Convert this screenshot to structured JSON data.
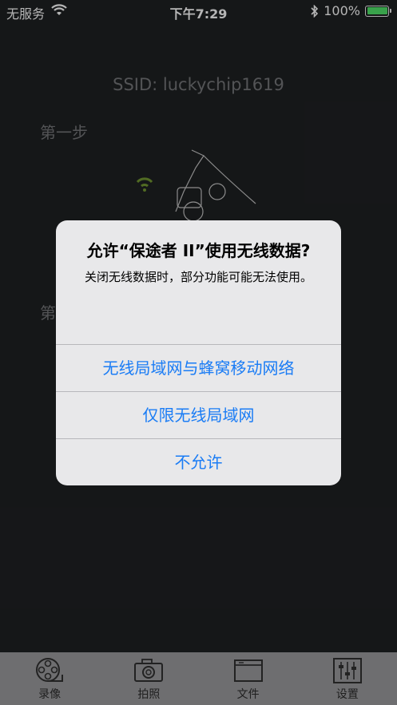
{
  "status_bar": {
    "carrier": "无服务",
    "time": "下午7:29",
    "battery_text": "100%",
    "battery_level": 1.0
  },
  "screen": {
    "ssid": "SSID: luckychip1619",
    "step1": "第一步",
    "step2_partial": "第"
  },
  "alert": {
    "title": "允许“保途者 II”使用无线数据?",
    "message": "关闭无线数据时，部分功能可能无法使用。",
    "buttons": [
      "无线局域网与蜂窝移动网络",
      "仅限无线局域网",
      "不允许"
    ],
    "button_color": "#1a7cf5"
  },
  "tabs": [
    {
      "label": "录像",
      "icon": "film-reel-icon"
    },
    {
      "label": "拍照",
      "icon": "camera-icon"
    },
    {
      "label": "文件",
      "icon": "folder-icon"
    },
    {
      "label": "设置",
      "icon": "sliders-icon"
    }
  ]
}
